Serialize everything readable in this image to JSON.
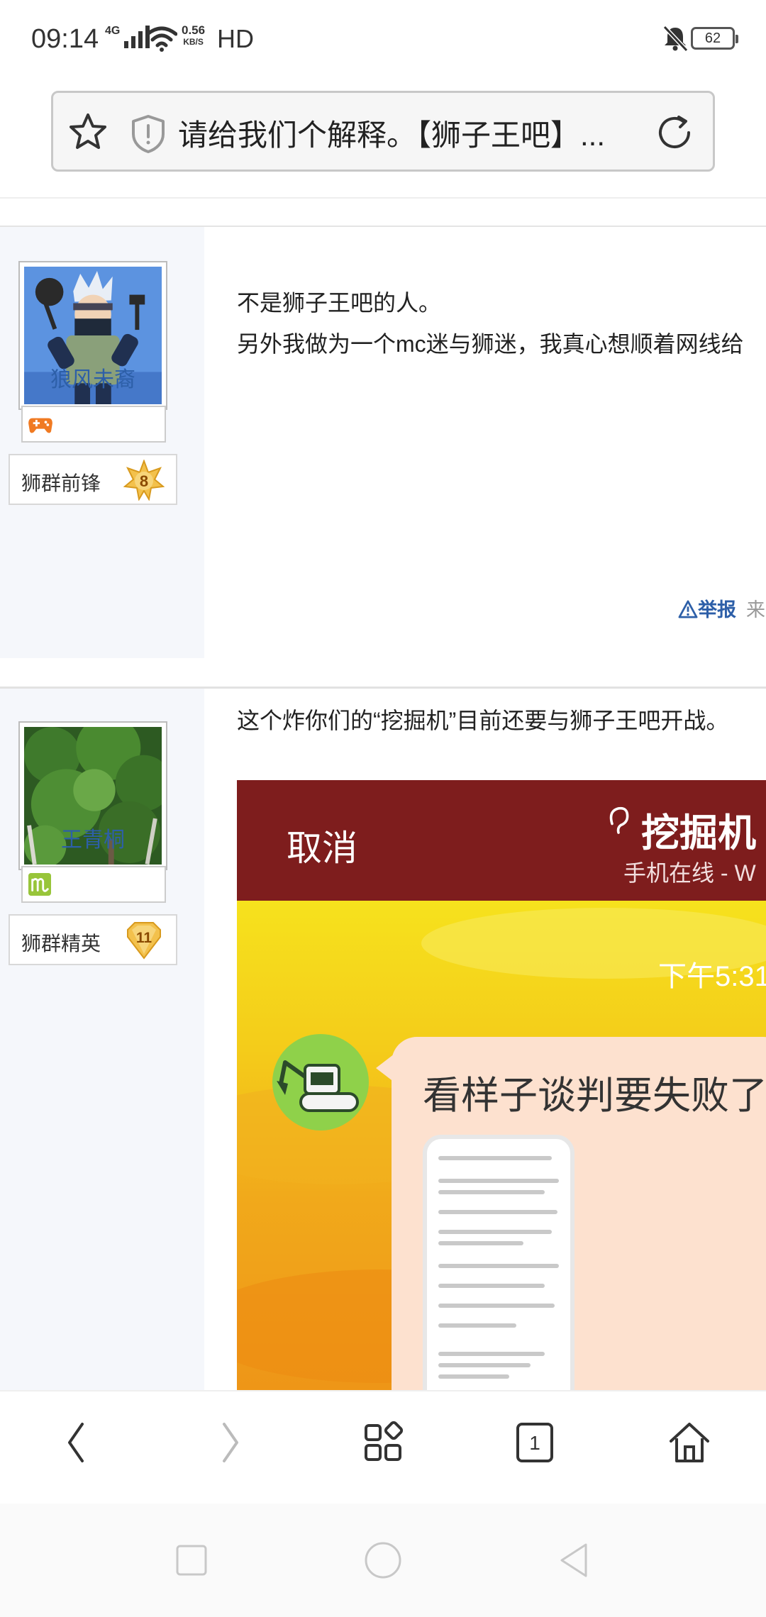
{
  "status_bar": {
    "time": "09:14",
    "network": "4G",
    "speed_top": "0.56",
    "speed_bottom": "KB/S",
    "hd": "HD",
    "battery": "62"
  },
  "url_bar": {
    "title": "请给我们个解释。【狮子王吧】..."
  },
  "posts": [
    {
      "username": "狼风未裔",
      "rank_label": "狮群前锋",
      "rank_level": "8",
      "lines": [
        "不是狮子王吧的人。",
        "另外我做为一个mc迷与狮迷，我真心想顺着网线给"
      ],
      "report_label": "举报",
      "more_label": "来"
    },
    {
      "username": "王青桐",
      "rank_label": "狮群精英",
      "rank_level": "11",
      "lines": [
        "这个炸你们的“挖掘机”目前还要与狮子王吧开战。"
      ],
      "embedded": {
        "cancel": "取消",
        "title": "挖掘机",
        "subtitle": "手机在线 - W",
        "time": "下午5:31",
        "message": "看样子谈判要失败了"
      }
    }
  ],
  "colors": {
    "link": "#2d5fa8",
    "sidebar": "#f5f7fb",
    "embedded_header": "#7e1d1d"
  }
}
